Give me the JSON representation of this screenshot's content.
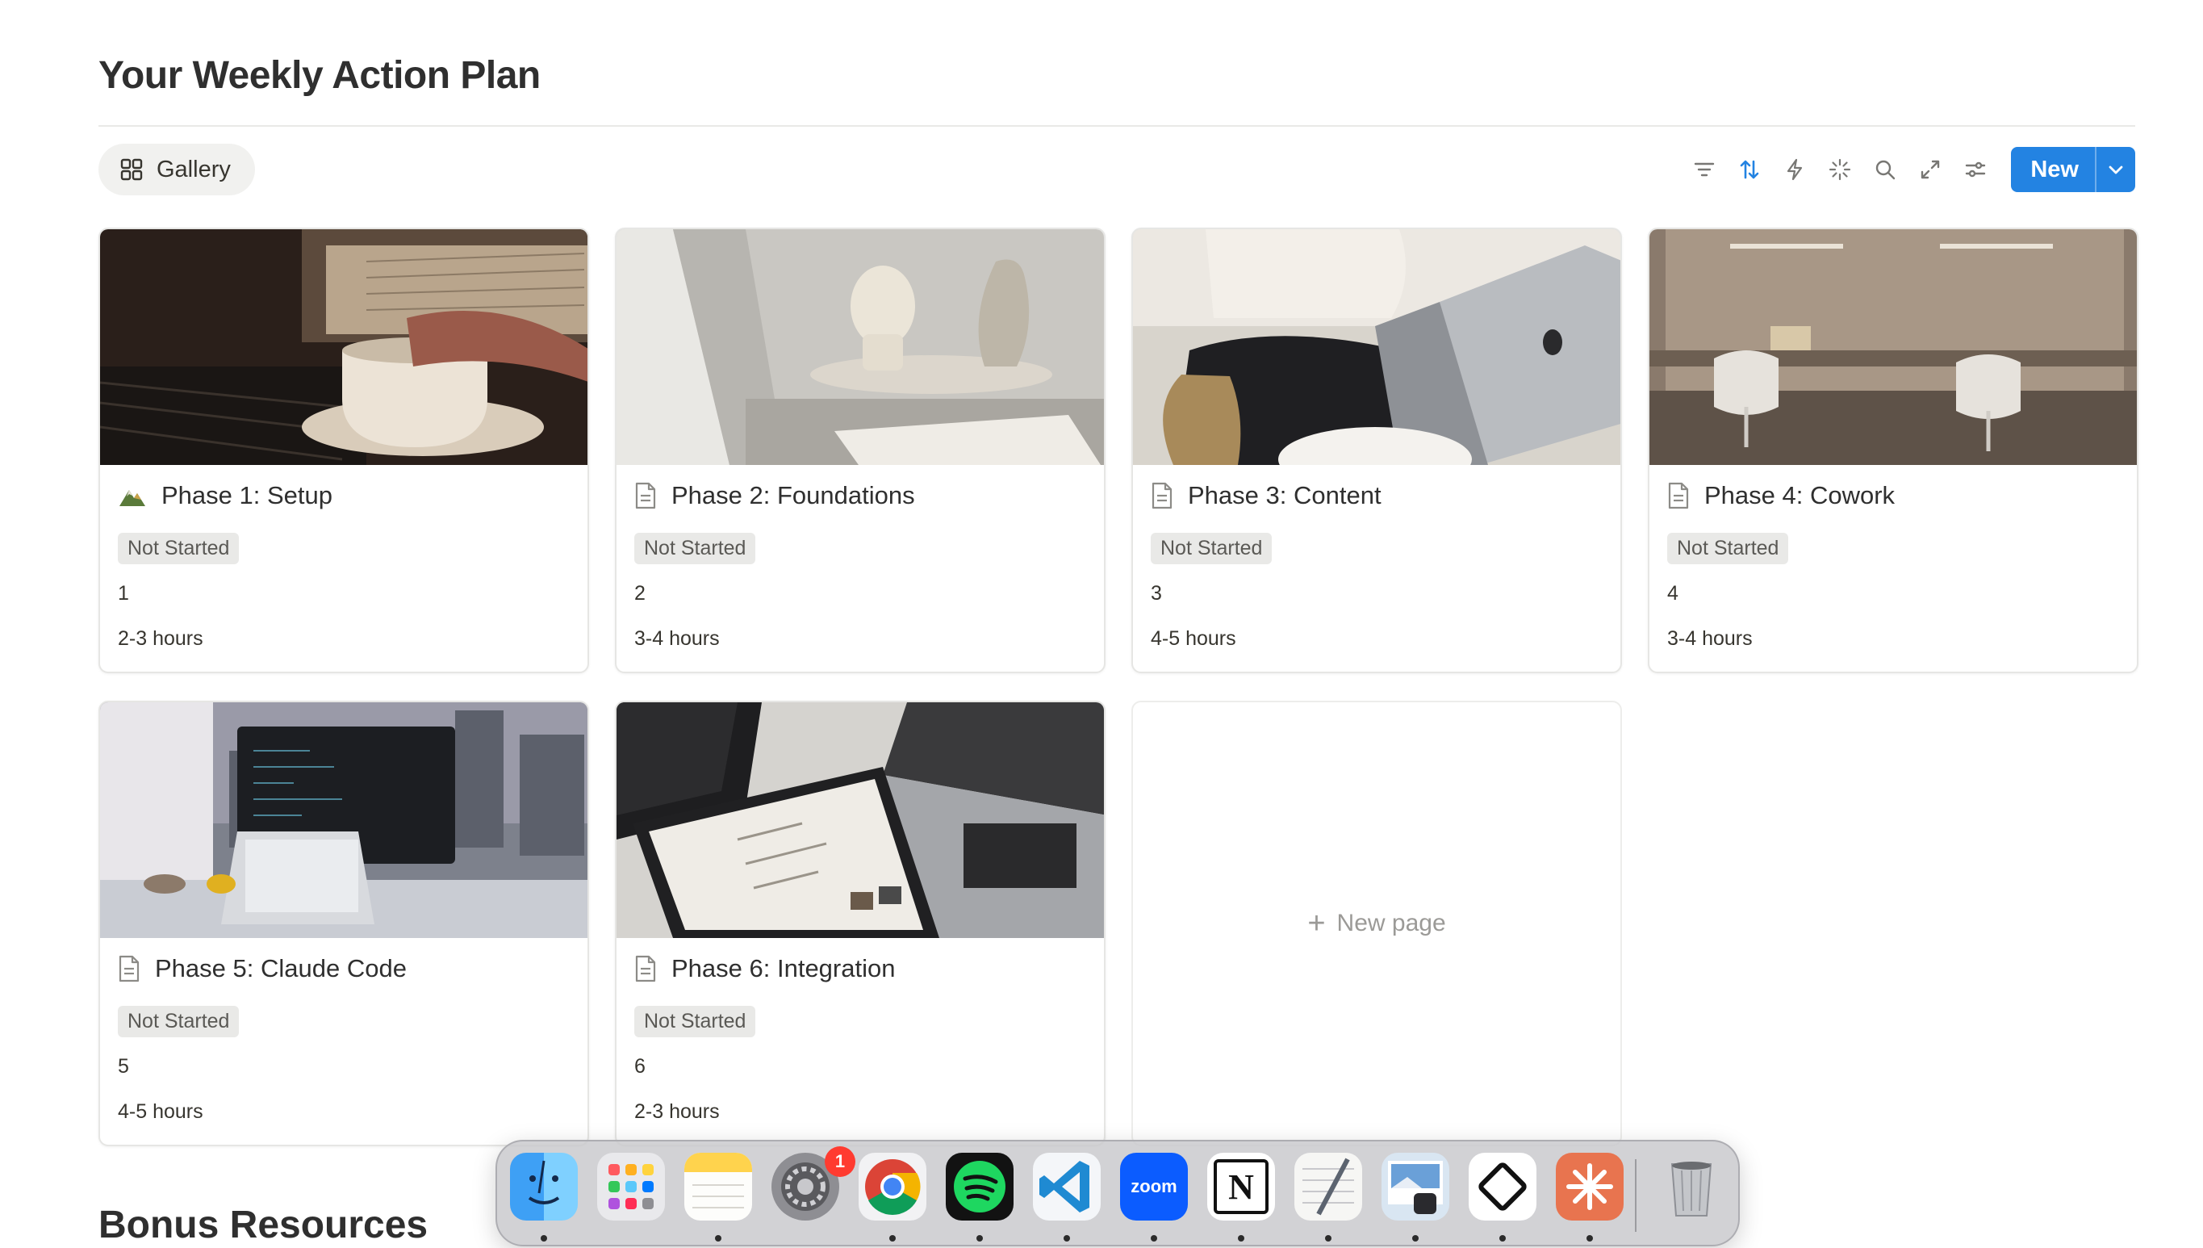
{
  "page": {
    "title": "Your Weekly Action Plan",
    "view_tab_label": "Gallery",
    "new_button_label": "New",
    "new_page_label": "New page",
    "next_section_title": "Bonus Resources"
  },
  "toolbar": {
    "icons": [
      "filter-icon",
      "sort-icon",
      "automation-bolt-icon",
      "ai-sparkle-icon",
      "search-icon",
      "expand-icon",
      "settings-sliders-icon"
    ],
    "accent_color": "#2383e2"
  },
  "cards": [
    {
      "title": "Phase 1: Setup",
      "icon": "mountain-emoji-icon",
      "status": "Not Started",
      "order": "1",
      "duration": "2-3 hours"
    },
    {
      "title": "Phase 2: Foundations",
      "icon": "page-icon",
      "status": "Not Started",
      "order": "2",
      "duration": "3-4 hours"
    },
    {
      "title": "Phase 3: Content",
      "icon": "page-icon",
      "status": "Not Started",
      "order": "3",
      "duration": "4-5 hours"
    },
    {
      "title": "Phase 4: Cowork",
      "icon": "page-icon",
      "status": "Not Started",
      "order": "4",
      "duration": "3-4 hours"
    },
    {
      "title": "Phase 5: Claude Code",
      "icon": "page-icon",
      "status": "Not Started",
      "order": "5",
      "duration": "4-5 hours"
    },
    {
      "title": "Phase 6: Integration",
      "icon": "page-icon",
      "status": "Not Started",
      "order": "6",
      "duration": "2-3 hours"
    }
  ],
  "dock": {
    "apps": [
      "Finder",
      "Launchpad",
      "Notes",
      "System Settings",
      "Chrome",
      "Spotify",
      "VS Code",
      "Zoom",
      "Notion",
      "TextEdit",
      "Preview",
      "Linear",
      "Claude",
      "Trash"
    ],
    "settings_badge": "1",
    "zoom_label": "zoom",
    "notion_label": "N"
  }
}
